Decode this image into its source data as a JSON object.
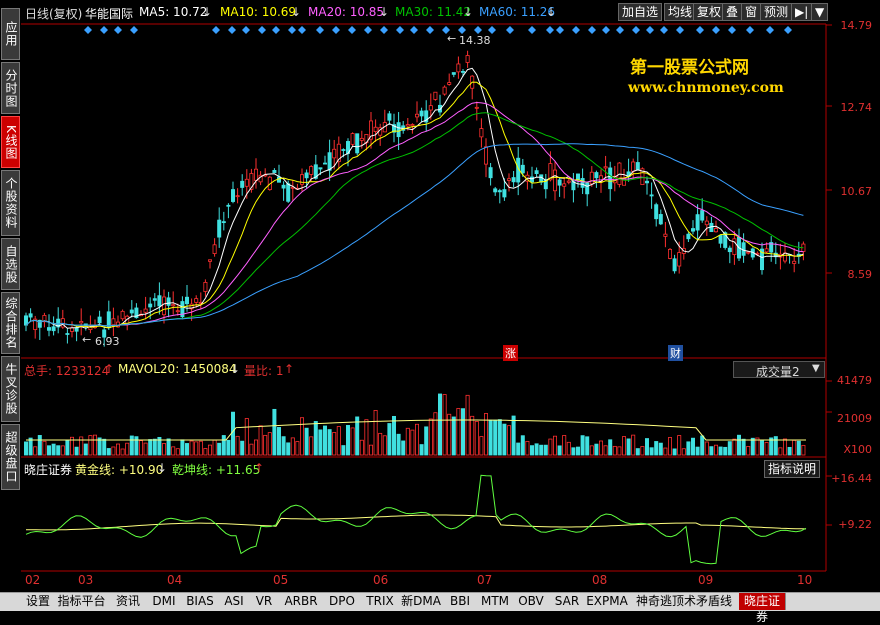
{
  "sidebar": {
    "items": [
      {
        "label": "应用"
      },
      {
        "label": "分时图"
      },
      {
        "label": "K线图"
      },
      {
        "label": "个股资料"
      },
      {
        "label": "自选股"
      },
      {
        "label": "综合排名"
      },
      {
        "label": "牛叉诊股"
      },
      {
        "label": "超级盘口"
      }
    ]
  },
  "header": {
    "period": "日线(复权)",
    "stock_name": "华能国际",
    "ma5": "MA5: 10.72",
    "ma10": "MA10: 10.69",
    "ma20": "MA20: 10.85",
    "ma30": "MA30: 11.42",
    "ma60": "MA60: 11.26",
    "arrow_down": "↓",
    "buttons": [
      "加自选",
      "均线",
      "复权",
      "叠",
      "窗",
      "预测"
    ],
    "nav_label": "▶|",
    "dropdown_arrow": "▼"
  },
  "price_axis": [
    "14.79",
    "12.74",
    "10.67",
    "8.59"
  ],
  "annotations": {
    "high": "14.38",
    "low": "6.93",
    "zhang": "涨",
    "cai": "财"
  },
  "watermark": {
    "line1": "第一股票公式网",
    "line2": "www.chnmoney.com"
  },
  "volume_panel": {
    "total": "总手: 1233124",
    "mavol": "MAVOL20: 1450084",
    "ratio": "量比: 1",
    "up_arrow": "↑",
    "down_arrow": "↓",
    "selector": "成交量2",
    "axis": [
      "41479",
      "21009",
      "X100"
    ]
  },
  "indicator_panel": {
    "name": "晓庄证券",
    "gold": "黄金线: +10.90",
    "qk": "乾坤线: +11.65",
    "up_arrow": "↑",
    "down_arrow": "↓",
    "help_button": "指标说明",
    "axis": [
      "+16.44",
      "+9.22"
    ]
  },
  "dates": [
    "02",
    "03",
    "04",
    "05",
    "06",
    "07",
    "08",
    "09",
    "10"
  ],
  "bottom_tabs": [
    "设置",
    "指标平台",
    "资讯",
    "DMI",
    "BIAS",
    "ASI",
    "VR",
    "ARBR",
    "DPO",
    "TRIX",
    "新DMA",
    "BBI",
    "MTM",
    "OBV",
    "SAR",
    "EXPMA",
    "神奇逃顶术矛盾线",
    "晓庄证券"
  ],
  "colors": {
    "up": "#ff3030",
    "down": "#40e0e0",
    "ma5": "#ffffff",
    "ma10": "#ffff00",
    "ma20": "#ff60ff",
    "ma30": "#00c000",
    "ma60": "#3aa0ff"
  }
}
